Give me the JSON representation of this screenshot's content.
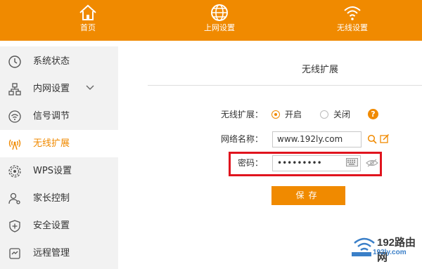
{
  "topnav": {
    "items": [
      {
        "label": "首页",
        "icon": "home-icon"
      },
      {
        "label": "上网设置",
        "icon": "globe-icon"
      },
      {
        "label": "无线设置",
        "icon": "wifi-icon"
      }
    ]
  },
  "sidebar": {
    "items": [
      {
        "label": "系统状态",
        "icon": "clock-icon"
      },
      {
        "label": "内网设置",
        "icon": "network-icon"
      },
      {
        "label": "信号调节",
        "icon": "signal-icon"
      },
      {
        "label": "无线扩展",
        "icon": "wireless-extend-icon"
      },
      {
        "label": "WPS设置",
        "icon": "wps-gear-icon"
      },
      {
        "label": "家长控制",
        "icon": "parent-user-icon"
      },
      {
        "label": "安全设置",
        "icon": "shield-icon"
      },
      {
        "label": "远程管理",
        "icon": "remote-icon"
      }
    ],
    "active_index": 3
  },
  "main": {
    "title": "无线扩展",
    "extend_label": "无线扩展：",
    "option_on": "开启",
    "option_off": "关闭",
    "selected": "开启",
    "help_glyph": "?",
    "ssid_label": "网络名称：",
    "ssid_value": "www.192ly.com",
    "password_label": "密码：",
    "password_value": "•••••••••",
    "save_label": "保存"
  },
  "watermark": {
    "brand": "192路由网",
    "url": "192ly.com"
  },
  "colors": {
    "accent": "#f08a00",
    "highlight": "#e0141e",
    "sidebar_bg": "#f2f2f2"
  }
}
